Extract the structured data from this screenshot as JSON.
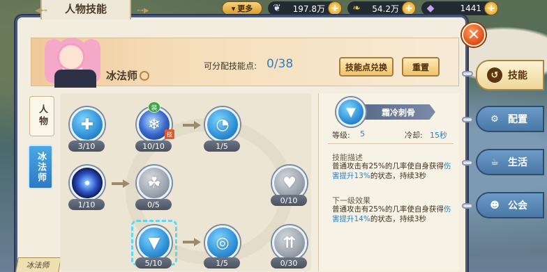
{
  "topbar": {
    "more_label": "更多",
    "resources": [
      {
        "icon": "feather-icon",
        "value": "197.8万"
      },
      {
        "icon": "leaf-gold-icon",
        "value": "54.2万"
      },
      {
        "icon": "crystal-icon",
        "value": "1441"
      }
    ]
  },
  "panel": {
    "title": "人物技能",
    "class_name": "冰法师",
    "points_label": "可分配技能点:",
    "points_value": "0/38",
    "exchange_button": "技能点兑换",
    "reset_button": "重置"
  },
  "left_tabs": [
    {
      "label": "人物",
      "active": false
    },
    {
      "label": "冰法师",
      "active": true
    }
  ],
  "corner_tag": "冰法师",
  "skills": [
    {
      "id": "s1",
      "count": "3/10",
      "style": "blue",
      "glyph": "✚"
    },
    {
      "id": "s2",
      "count": "10/10",
      "style": "ice",
      "glyph": "❄",
      "equip_badge": "装",
      "skill_badge": "技"
    },
    {
      "id": "s3",
      "count": "1/5",
      "style": "blue",
      "glyph": "◔"
    },
    {
      "id": "s4",
      "count": "1/10",
      "style": "orb",
      "glyph": ""
    },
    {
      "id": "s5",
      "count": "0/5",
      "style": "grey",
      "glyph": "☘"
    },
    {
      "id": "s6",
      "count": "0/10",
      "style": "grey",
      "glyph": "♥"
    },
    {
      "id": "s7",
      "count": "5/10",
      "style": "blue",
      "glyph": "▼"
    },
    {
      "id": "s8",
      "count": "1/5",
      "style": "blue",
      "glyph": "◎"
    },
    {
      "id": "s9",
      "count": "0/30",
      "style": "grey",
      "glyph": "⇈"
    }
  ],
  "detail": {
    "name": "霜冷刺骨",
    "level_label": "等级:",
    "level_value": "5",
    "cooldown_label": "冷却:",
    "cooldown_value": "15秒",
    "desc_title": "技能描述",
    "desc_pre": "普通攻击有25%的几率使自身获得",
    "desc_hl": "伤害提升13%",
    "desc_post": "的状态，持续3秒",
    "next_title": "下一级效果",
    "next_pre": "普通攻击有25%的几率使自身获得",
    "next_hl": "伤害提升14%",
    "next_post": "的状态，持续3秒"
  },
  "right_tabs": [
    {
      "label": "技能",
      "icon": "skill-icon",
      "active": true
    },
    {
      "label": "配置",
      "icon": "gear-icon",
      "active": false
    },
    {
      "label": "生活",
      "icon": "cup-icon",
      "active": false
    },
    {
      "label": "公会",
      "icon": "guild-icon",
      "active": false
    }
  ]
}
